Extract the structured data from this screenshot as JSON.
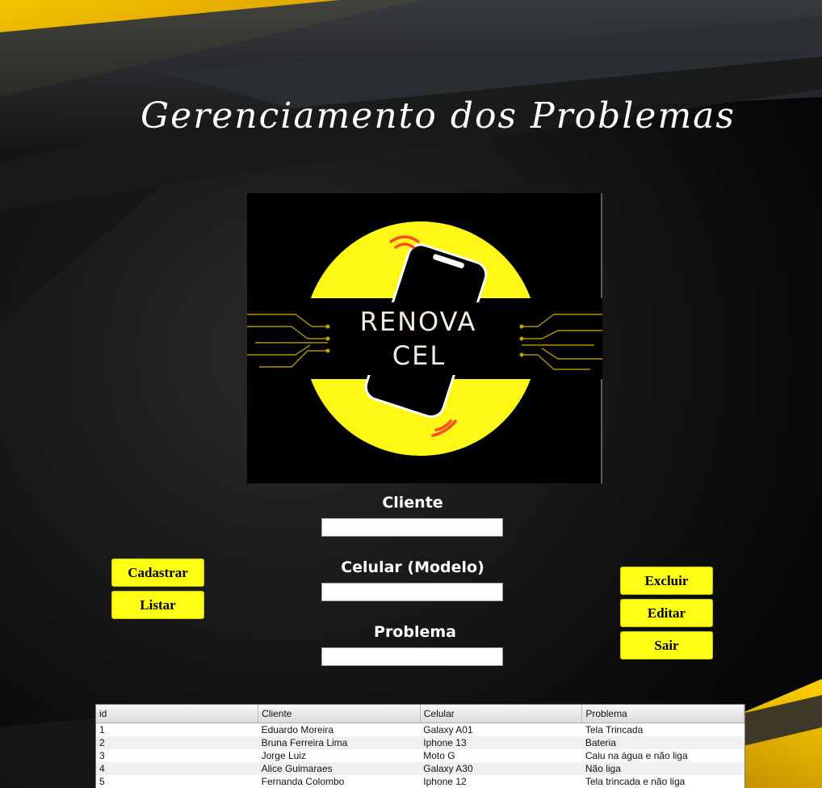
{
  "window": {
    "title": "Gerenciamento dos Problemas",
    "brand_colors": {
      "accent_yellow": "#ffff16",
      "background": "#0b0b0b"
    }
  },
  "logo": {
    "line1": "RENOVA",
    "line2": "CEL",
    "icon": "smartphone-icon"
  },
  "form": {
    "cliente_label": "Cliente",
    "cliente_value": "",
    "celular_label": "Celular (Modelo)",
    "celular_value": "",
    "problema_label": "Problema",
    "problema_value": ""
  },
  "buttons": {
    "cadastrar": "Cadastrar",
    "listar": "Listar",
    "excluir": "Excluir",
    "editar": "Editar",
    "sair": "Sair"
  },
  "table": {
    "headers": [
      "id",
      "Cliente",
      "Celular",
      "Problema"
    ],
    "rows": [
      [
        "1",
        "Eduardo Moreira",
        "Galaxy A01",
        "Tela Trincada"
      ],
      [
        "2",
        "Bruna Ferreira Lima",
        "Iphone 13",
        "Bateria"
      ],
      [
        "3",
        "Jorge Luiz",
        "Moto G",
        "Caiu na água e não liga"
      ],
      [
        "4",
        "Alice Guimaraes",
        "Galaxy A30",
        "Não liga"
      ],
      [
        "5",
        "Fernanda Colombo",
        "Iphone 12",
        "Tela trincada e não liga"
      ]
    ]
  }
}
